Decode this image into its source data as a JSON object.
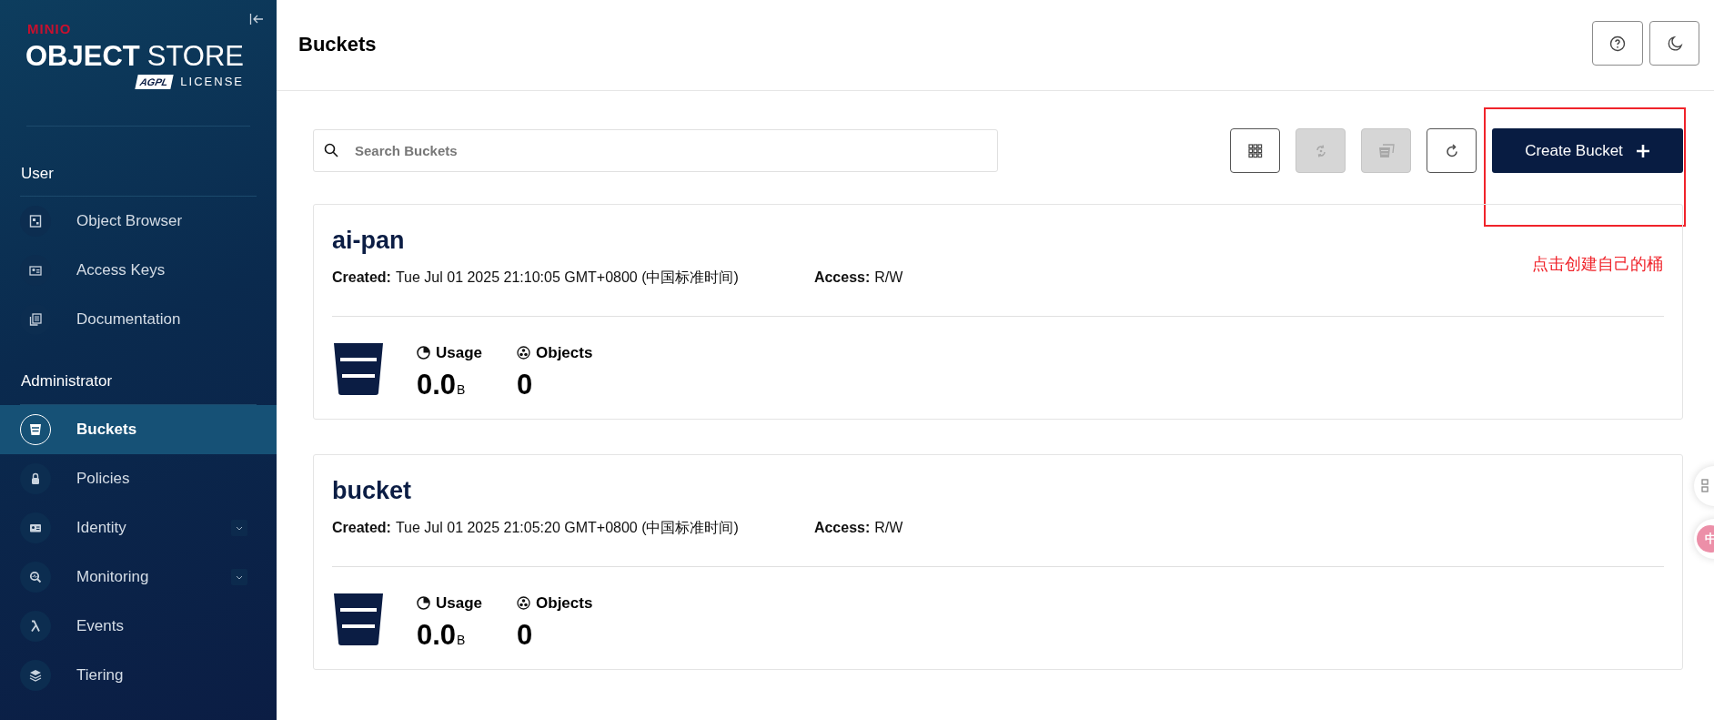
{
  "sidebar": {
    "logo": {
      "brand": "MINIO",
      "product_bold": "OBJECT",
      "product_light": "STORE",
      "badge": "AGPL",
      "license": "LICENSE"
    },
    "sections": [
      {
        "title": "User",
        "items": [
          {
            "label": "Object Browser",
            "selected": false,
            "expandable": false
          },
          {
            "label": "Access Keys",
            "selected": false,
            "expandable": false
          },
          {
            "label": "Documentation",
            "selected": false,
            "expandable": false
          }
        ]
      },
      {
        "title": "Administrator",
        "items": [
          {
            "label": "Buckets",
            "selected": true,
            "expandable": false
          },
          {
            "label": "Policies",
            "selected": false,
            "expandable": false
          },
          {
            "label": "Identity",
            "selected": false,
            "expandable": true
          },
          {
            "label": "Monitoring",
            "selected": false,
            "expandable": true
          },
          {
            "label": "Events",
            "selected": false,
            "expandable": false
          },
          {
            "label": "Tiering",
            "selected": false,
            "expandable": false
          }
        ]
      }
    ]
  },
  "header": {
    "title": "Buckets"
  },
  "search": {
    "placeholder": "Search Buckets"
  },
  "toolbar": [
    {
      "disabled": false
    },
    {
      "disabled": true
    },
    {
      "disabled": true
    },
    {
      "disabled": false
    }
  ],
  "create_button": {
    "label": "Create Bucket"
  },
  "annotation": {
    "text": "点击创建自己的桶"
  },
  "buckets": [
    {
      "name": "ai-pan",
      "created_label": "Created:",
      "created": "Tue Jul 01 2025 21:10:05 GMT+0800 (中国标准时间)",
      "access_label": "Access:",
      "access": "R/W",
      "usage_label": "Usage",
      "usage": "0.0",
      "usage_unit": "B",
      "objects_label": "Objects",
      "objects": "0"
    },
    {
      "name": "bucket",
      "created_label": "Created:",
      "created": "Tue Jul 01 2025 21:05:20 GMT+0800 (中国标准时间)",
      "access_label": "Access:",
      "access": "R/W",
      "usage_label": "Usage",
      "usage": "0.0",
      "usage_unit": "B",
      "objects_label": "Objects",
      "objects": "0"
    }
  ],
  "floating": {
    "ime_label": "中"
  }
}
